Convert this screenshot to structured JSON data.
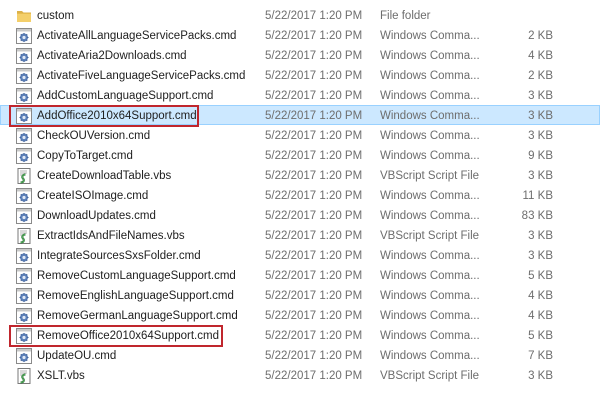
{
  "files": [
    {
      "name": "custom",
      "date": "5/22/2017 1:20 PM",
      "type": "File folder",
      "size": "",
      "icon": "folder-icon"
    },
    {
      "name": "ActivateAllLanguageServicePacks.cmd",
      "date": "5/22/2017 1:20 PM",
      "type": "Windows Comma...",
      "size": "2 KB",
      "icon": "cmd-file-icon"
    },
    {
      "name": "ActivateAria2Downloads.cmd",
      "date": "5/22/2017 1:20 PM",
      "type": "Windows Comma...",
      "size": "4 KB",
      "icon": "cmd-file-icon"
    },
    {
      "name": "ActivateFiveLanguageServicePacks.cmd",
      "date": "5/22/2017 1:20 PM",
      "type": "Windows Comma...",
      "size": "2 KB",
      "icon": "cmd-file-icon"
    },
    {
      "name": "AddCustomLanguageSupport.cmd",
      "date": "5/22/2017 1:20 PM",
      "type": "Windows Comma...",
      "size": "3 KB",
      "icon": "cmd-file-icon"
    },
    {
      "name": "AddOffice2010x64Support.cmd",
      "date": "5/22/2017 1:20 PM",
      "type": "Windows Comma...",
      "size": "3 KB",
      "icon": "cmd-file-icon",
      "selected": true
    },
    {
      "name": "CheckOUVersion.cmd",
      "date": "5/22/2017 1:20 PM",
      "type": "Windows Comma...",
      "size": "3 KB",
      "icon": "cmd-file-icon"
    },
    {
      "name": "CopyToTarget.cmd",
      "date": "5/22/2017 1:20 PM",
      "type": "Windows Comma...",
      "size": "9 KB",
      "icon": "cmd-file-icon"
    },
    {
      "name": "CreateDownloadTable.vbs",
      "date": "5/22/2017 1:20 PM",
      "type": "VBScript Script File",
      "size": "3 KB",
      "icon": "vbs-file-icon"
    },
    {
      "name": "CreateISOImage.cmd",
      "date": "5/22/2017 1:20 PM",
      "type": "Windows Comma...",
      "size": "11 KB",
      "icon": "cmd-file-icon"
    },
    {
      "name": "DownloadUpdates.cmd",
      "date": "5/22/2017 1:20 PM",
      "type": "Windows Comma...",
      "size": "83 KB",
      "icon": "cmd-file-icon"
    },
    {
      "name": "ExtractIdsAndFileNames.vbs",
      "date": "5/22/2017 1:20 PM",
      "type": "VBScript Script File",
      "size": "3 KB",
      "icon": "vbs-file-icon"
    },
    {
      "name": "IntegrateSourcesSxsFolder.cmd",
      "date": "5/22/2017 1:20 PM",
      "type": "Windows Comma...",
      "size": "3 KB",
      "icon": "cmd-file-icon"
    },
    {
      "name": "RemoveCustomLanguageSupport.cmd",
      "date": "5/22/2017 1:20 PM",
      "type": "Windows Comma...",
      "size": "5 KB",
      "icon": "cmd-file-icon"
    },
    {
      "name": "RemoveEnglishLanguageSupport.cmd",
      "date": "5/22/2017 1:20 PM",
      "type": "Windows Comma...",
      "size": "4 KB",
      "icon": "cmd-file-icon"
    },
    {
      "name": "RemoveGermanLanguageSupport.cmd",
      "date": "5/22/2017 1:20 PM",
      "type": "Windows Comma...",
      "size": "4 KB",
      "icon": "cmd-file-icon"
    },
    {
      "name": "RemoveOffice2010x64Support.cmd",
      "date": "5/22/2017 1:20 PM",
      "type": "Windows Comma...",
      "size": "5 KB",
      "icon": "cmd-file-icon"
    },
    {
      "name": "UpdateOU.cmd",
      "date": "5/22/2017 1:20 PM",
      "type": "Windows Comma...",
      "size": "7 KB",
      "icon": "cmd-file-icon"
    },
    {
      "name": "XSLT.vbs",
      "date": "5/22/2017 1:20 PM",
      "type": "VBScript Script File",
      "size": "3 KB",
      "icon": "vbs-file-icon"
    }
  ],
  "highlighted_files": [
    "AddOffice2010x64Support.cmd",
    "RemoveOffice2010x64Support.cmd"
  ],
  "colors": {
    "selection": "#cce8ff",
    "highlight_box": "#c0262d"
  }
}
